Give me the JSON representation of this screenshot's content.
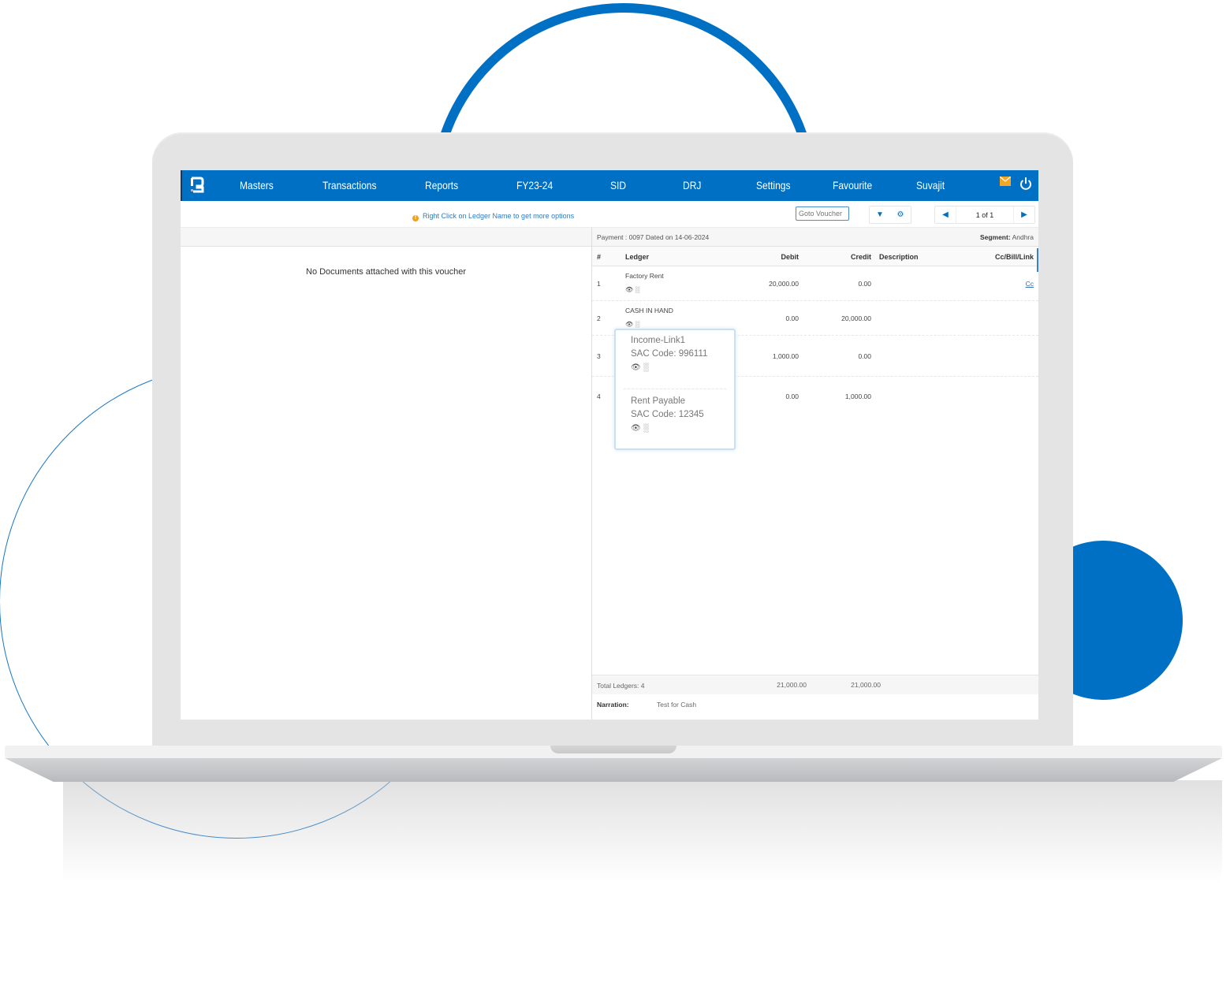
{
  "nav": {
    "items": [
      "Masters",
      "Transactions",
      "Reports",
      "FY23-24",
      "SID",
      "DRJ",
      "Settings",
      "Favourite",
      "Suvajit"
    ]
  },
  "toolbar": {
    "hint": "Right Click on Ledger Name to get more options",
    "goto_placeholder": "Goto Voucher",
    "pager": "1 of 1"
  },
  "left_pane": {
    "empty_message": "No Documents attached with this voucher"
  },
  "voucher": {
    "info": "Payment : 0097  Dated on  14-06-2024",
    "segment_label": "Segment:",
    "segment_value": "Andhra",
    "columns": [
      "#",
      "Ledger",
      "Debit",
      "Credit",
      "Description",
      "Cc/Bill/Link"
    ],
    "rows": [
      {
        "num": "1",
        "ledger": "Factory Rent",
        "debit": "20,000.00",
        "credit": "0.00",
        "cc": "Cc"
      },
      {
        "num": "2",
        "ledger": "CASH IN HAND",
        "debit": "0.00",
        "credit": "20,000.00",
        "cc": ""
      },
      {
        "num": "3",
        "ledger": "Income-Link1",
        "debit": "1,000.00",
        "credit": "0.00",
        "cc": ""
      },
      {
        "num": "4",
        "ledger": "Rent Payable",
        "debit": "0.00",
        "credit": "1,000.00",
        "cc": ""
      }
    ],
    "popup": [
      {
        "name": "Income-Link1",
        "sac": "SAC Code: 996111"
      },
      {
        "name": "Rent Payable",
        "sac": "SAC Code: 12345"
      }
    ],
    "totals": {
      "label": "Total Ledgers: 4",
      "debit": "21,000.00",
      "credit": "21,000.00"
    },
    "narration_label": "Narration:",
    "narration": "Test for Cash"
  },
  "colors": {
    "brand": "#0070c4",
    "mail": "#f5a623"
  }
}
